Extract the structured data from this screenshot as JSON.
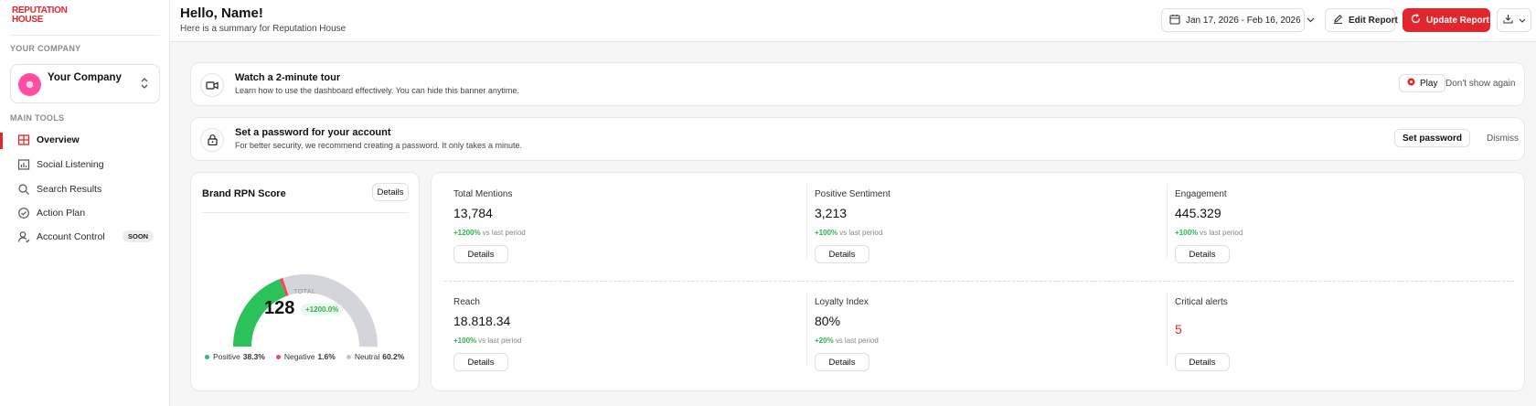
{
  "logo": {
    "line1": "REPUTATION",
    "line2": "HOUSE"
  },
  "sidebar": {
    "company_section": "YOUR COMPANY",
    "company_name": "Your Company",
    "tools_section": "MAIN TOOLS",
    "items": [
      {
        "label": "Overview",
        "active": true,
        "icon": "grid-icon"
      },
      {
        "label": "Social Listening",
        "active": false,
        "icon": "chart-icon"
      },
      {
        "label": "Search Results",
        "active": false,
        "icon": "search-icon"
      },
      {
        "label": "Action Plan",
        "active": false,
        "icon": "check-circle-icon"
      },
      {
        "label": "Account Control",
        "active": false,
        "icon": "user-icon",
        "badge": "SOON"
      }
    ]
  },
  "header": {
    "greeting": "Hello, Name!",
    "subtitle": "Here is a summary for Reputation House",
    "date_range": "Jan 17, 2026 - Feb 16, 2026",
    "edit_label": "Edit Report",
    "update_label": "Update Report"
  },
  "banners": [
    {
      "title": "Watch a 2-minute tour",
      "text": "Learn how to use the dashboard effectively. You can hide this banner anytime.",
      "action": "Play",
      "dismiss": "Don't show again",
      "icon": "video-icon"
    },
    {
      "title": "Set a password for your account",
      "text": "For better security, we recommend creating a password. It only takes a minute.",
      "action": "Set password",
      "dismiss": "Dismiss",
      "icon": "lock-icon"
    }
  ],
  "rpn": {
    "title": "Brand RPN Score",
    "details": "Details",
    "total_label": "TOTAL",
    "total_value": "128",
    "total_change": "+1200.0%",
    "breakdown": [
      {
        "label": "Positive",
        "value": "38.3%",
        "fraction": 0.383,
        "color": "#2bc25a"
      },
      {
        "label": "Negative",
        "value": "1.6%",
        "fraction": 0.016,
        "color": "#ef4b58"
      },
      {
        "label": "Neutral",
        "value": "60.2%",
        "fraction": 0.602,
        "color": "#d3d5da"
      }
    ]
  },
  "metrics": [
    {
      "title": "Total Mentions",
      "value": "13,784",
      "change": "+1200%",
      "suffix": "vs last period",
      "details": "Details"
    },
    {
      "title": "Positive Sentiment",
      "value": "3,213",
      "change": "+100%",
      "suffix": "vs last period",
      "details": "Details"
    },
    {
      "title": "Engagement",
      "value": "445.329",
      "change": "+100%",
      "suffix": "vs last period",
      "details": "Details"
    },
    {
      "title": "Reach",
      "value": "18.818.34",
      "change": "+100%",
      "suffix": "vs last period",
      "details": "Details"
    },
    {
      "title": "Loyalty Index",
      "value": "80%",
      "change": "+20%",
      "suffix": "vs last period",
      "details": "Details"
    },
    {
      "title": "Critical alerts",
      "value": "5",
      "details": "Details"
    }
  ]
}
